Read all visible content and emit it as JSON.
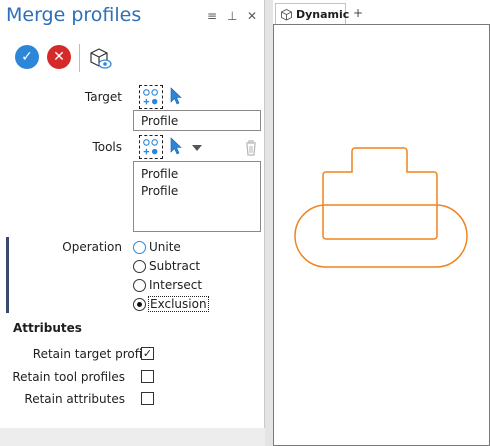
{
  "panel": {
    "title": "Merge profiles",
    "header_icons": [
      "menu-icon",
      "pin-icon",
      "close-icon"
    ],
    "toolbar": {
      "ok": "confirm-icon",
      "cancel": "cancel-icon",
      "preview": "preview-icon"
    },
    "target": {
      "label": "Target",
      "value": "Profile"
    },
    "tools": {
      "label": "Tools",
      "items": [
        "Profile",
        "Profile"
      ]
    },
    "operation": {
      "label": "Operation",
      "options": [
        "Unite",
        "Subtract",
        "Intersect",
        "Exclusion"
      ],
      "selected": "Exclusion"
    },
    "attributes": {
      "title": "Attributes",
      "items": [
        {
          "label": "Retain target profile",
          "checked": true
        },
        {
          "label": "Retain tool profiles",
          "checked": false
        },
        {
          "label": "Retain attributes",
          "checked": false
        }
      ]
    }
  },
  "viewport": {
    "tab_label": "Dynamic",
    "add_tab": "+",
    "stroke_color": "#f0821e"
  },
  "colors": {
    "title": "#2d6fb8",
    "ok": "#2e86d8",
    "cancel": "#d42a2a",
    "shape_stroke": "#f0821e"
  }
}
